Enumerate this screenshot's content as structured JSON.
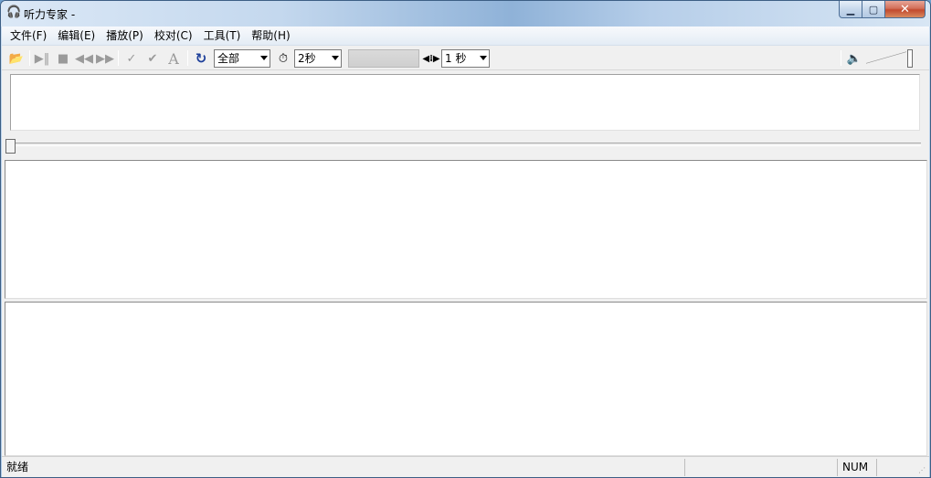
{
  "window": {
    "title": "听力专家 -",
    "icon": "headphone-icon",
    "controls": [
      "minimize-icon",
      "maximize-icon",
      "close-icon"
    ]
  },
  "menubar": {
    "items": [
      "文件(F)",
      "编辑(E)",
      "播放(P)",
      "校对(C)",
      "工具(T)",
      "帮助(H)"
    ]
  },
  "toolbar": {
    "loop_combo": "全部",
    "interval_combo": "2秒",
    "step_combo": "1 秒",
    "icons": {
      "open": "folder-open-icon",
      "play_pause": "play-pause-icon",
      "stop": "stop-icon",
      "rewind": "rewind-icon",
      "forward": "fast-forward-icon",
      "check": "check-icon",
      "check_all": "check-all-icon",
      "font": "font-icon",
      "repeat": "repeat-icon",
      "timer": "timer-icon",
      "seek_step": "seek-step-icon",
      "volume": "volume-icon"
    }
  },
  "status": {
    "text": "就绪",
    "num": "NUM"
  },
  "colors": {
    "close_button": "#c24a2f",
    "titlebar": "#c4d8ee",
    "client_bg": "#f0f0f0"
  }
}
